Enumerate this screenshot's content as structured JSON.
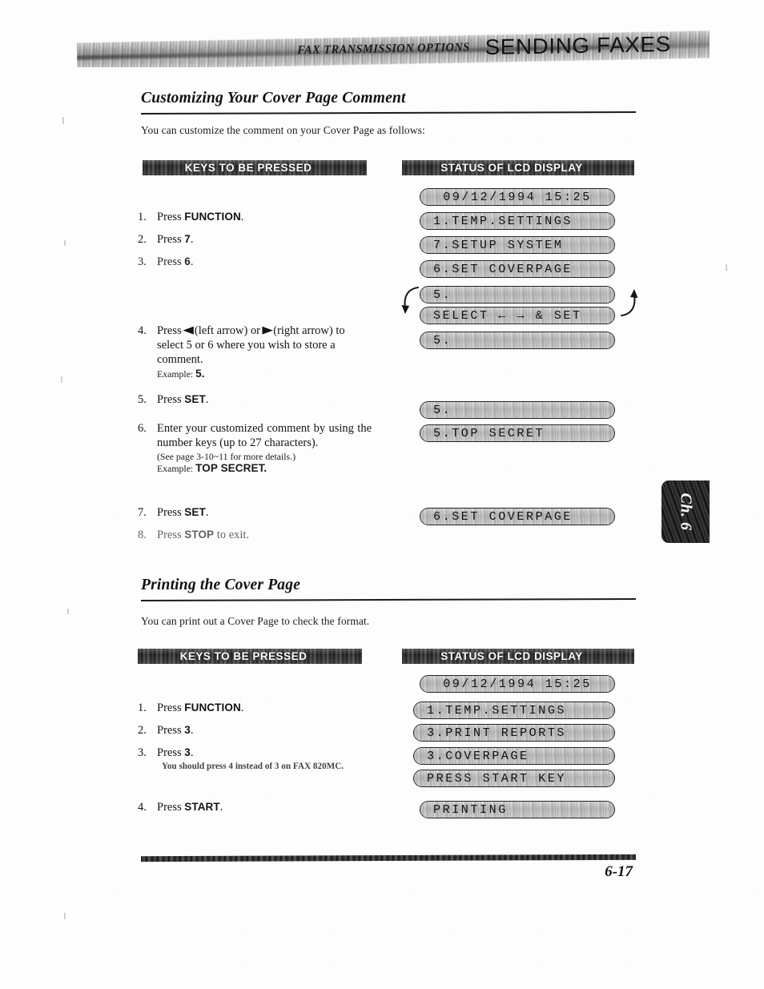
{
  "header": {
    "running_head": "FAX TRANSMISSION OPTIONS",
    "chapter_title": "SENDING FAXES"
  },
  "chapter_tab": {
    "label": "Ch. 6"
  },
  "footer": {
    "page_number": "6-17"
  },
  "sections": [
    {
      "title": "Customizing Your Cover Page Comment",
      "intro": "You can customize the comment on your Cover Page as follows:",
      "keys_banner": "KEYS TO BE PRESSED",
      "lcd_banner": "STATUS OF LCD DISPLAY",
      "steps": [
        {
          "num": "1.",
          "pre": "Press ",
          "key": "FUNCTION",
          "post": "."
        },
        {
          "num": "2.",
          "pre": "Press ",
          "key": "7",
          "post": "."
        },
        {
          "num": "3.",
          "pre": "Press ",
          "key": "6",
          "post": "."
        },
        {
          "num": "4.",
          "pre": "Press ",
          "arrow_left": "◀",
          "mid1": " (left arrow) or ",
          "arrow_right": "▶",
          "mid2": " (right arrow) to select 5 or 6 where you wish to store a comment.",
          "example_label": "Example: ",
          "example_value": "5."
        },
        {
          "num": "5.",
          "pre": "Press ",
          "key": "SET",
          "post": "."
        },
        {
          "num": "6.",
          "pre": "Enter your customized comment by using the number keys (up to 27 characters).",
          "note": "(See page 3-10~11 for more details.)",
          "example_label": "Example: ",
          "example_value": "TOP SECRET."
        },
        {
          "num": "7.",
          "pre": "Press ",
          "key": "SET",
          "post": "."
        },
        {
          "num": "8.",
          "pre": "Press ",
          "key": "STOP",
          "post": " to exit."
        }
      ],
      "lcd": [
        "09/12/1994 15:25",
        "1.TEMP.SETTINGS",
        "7.SETUP SYSTEM",
        "6.SET COVERPAGE",
        "5.",
        "SELECT ← → & SET",
        "5.",
        "5.",
        "5.TOP SECRET",
        "6.SET COVERPAGE"
      ]
    },
    {
      "title": "Printing the Cover Page",
      "intro": "You can print out a Cover Page to check the format.",
      "keys_banner": "KEYS TO BE PRESSED",
      "lcd_banner": "STATUS OF LCD DISPLAY",
      "steps": [
        {
          "num": "1.",
          "pre": "Press ",
          "key": "FUNCTION",
          "post": "."
        },
        {
          "num": "2.",
          "pre": "Press ",
          "key": "3",
          "post": "."
        },
        {
          "num": "3.",
          "pre": "Press ",
          "key": "3",
          "post": ".",
          "note": "You should press 4 instead of 3 on FAX 820MC."
        },
        {
          "num": "4.",
          "pre": "Press ",
          "key": "START",
          "post": "."
        }
      ],
      "lcd": [
        "09/12/1994 15:25",
        "1.TEMP.SETTINGS",
        "3.PRINT REPORTS",
        "3.COVERPAGE",
        "PRESS START KEY",
        "PRINTING"
      ]
    }
  ]
}
